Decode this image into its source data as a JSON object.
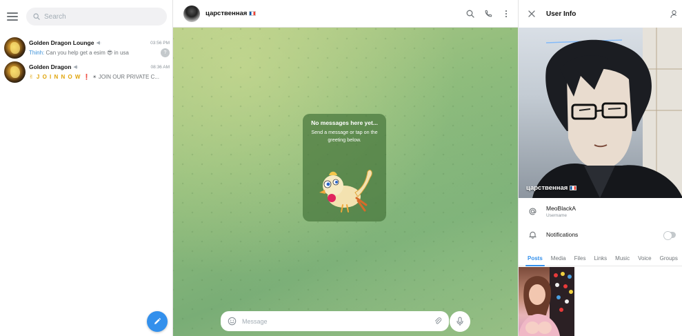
{
  "sidebar": {
    "search_placeholder": "Search",
    "chats": [
      {
        "name": "Golden Dragon Lounge",
        "time": "03:56 PM",
        "sender": "Thinh:",
        "preview": "Can you help get a esim 😎 in usa",
        "badge": "?"
      },
      {
        "name": "Golden Dragon",
        "time": "08:36 AM",
        "preview_gold": "✌ J O I N N O W ❗",
        "preview": "✴ JOIN OUR PRIVATE C..."
      }
    ]
  },
  "chat": {
    "title": "царственная",
    "empty_title": "No messages here yet...",
    "empty_subtitle": "Send a message or tap on the greeting below.",
    "composer_placeholder": "Message"
  },
  "user_info": {
    "header_title": "User Info",
    "display_name": "царственная",
    "username": "MeoBlackA",
    "username_label": "Username",
    "notifications_label": "Notifications",
    "tabs": [
      "Posts",
      "Media",
      "Files",
      "Links",
      "Music",
      "Voice",
      "Groups"
    ],
    "active_tab": "Posts"
  },
  "colors": {
    "accent": "#3390ec",
    "muted_text": "#707579",
    "chat_bg": "#8fbc7c",
    "gold_text": "#e0a40a"
  }
}
